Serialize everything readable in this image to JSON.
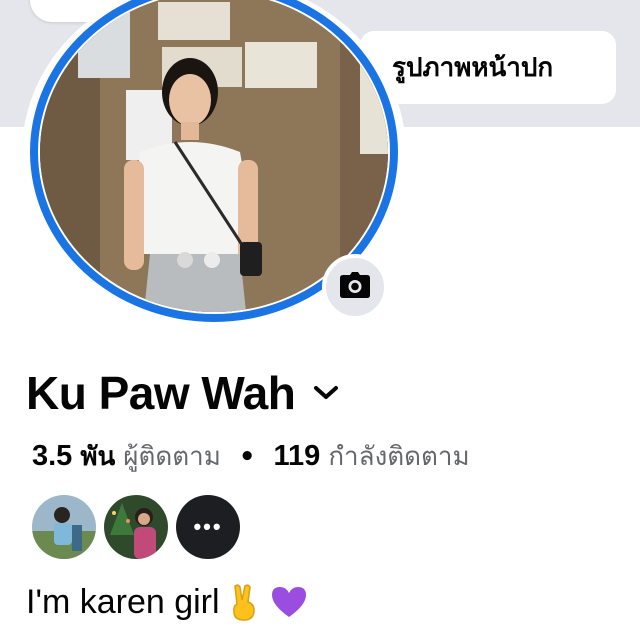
{
  "cover": {
    "edit_button_label": "รูปภาพหน้าปก"
  },
  "profile": {
    "name": "Ku Paw Wah",
    "followers_count": "3.5",
    "followers_unit": "พัน",
    "followers_label": "ผู้ติดตาม",
    "separator": "•",
    "following_count": "119",
    "following_label": "กำลังติดตาม",
    "bio_text": "I'm karen girl"
  },
  "friends": {
    "more_label": "•••"
  },
  "icons": {
    "camera": "camera-icon",
    "chevron": "chevron-down-icon",
    "bio_emojis": [
      "victory-hand-emoji",
      "purple-heart-emoji"
    ]
  },
  "colors": {
    "accent": "#1b74e4",
    "cover": "#e4e6eb",
    "secondary_text": "#65676b"
  }
}
